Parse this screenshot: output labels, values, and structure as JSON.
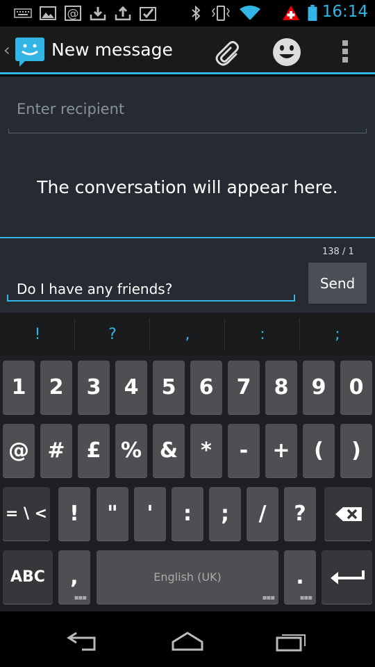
{
  "status_bar": {
    "time": "16:14",
    "icons": [
      "keyboard-icon",
      "gallery-icon",
      "email-icon",
      "download-icon",
      "upload-icon",
      "task-done-icon",
      "bluetooth-icon",
      "vibrate-icon",
      "wifi-icon",
      "swiss-flag-icon",
      "battery-icon"
    ]
  },
  "action_bar": {
    "title": "New message",
    "accent": "#33b5e5"
  },
  "compose": {
    "recipient_placeholder": "Enter recipient",
    "empty_message": "The conversation will appear here.",
    "char_count": "138 / 1",
    "message_text": "Do I have any friends?",
    "send_label": "Send"
  },
  "keyboard": {
    "suggestions": [
      "!",
      "?",
      ",",
      ":",
      ";"
    ],
    "row1": [
      "1",
      "2",
      "3",
      "4",
      "5",
      "6",
      "7",
      "8",
      "9",
      "0"
    ],
    "row2": [
      "@",
      "#",
      "£",
      "%",
      "&",
      "*",
      "-",
      "+",
      "(",
      ")"
    ],
    "row3": [
      "= \\ <",
      "!",
      "\"",
      "'",
      ":",
      ";",
      "/",
      "?"
    ],
    "row4": {
      "abc": "ABC",
      "comma": ",",
      "space": "English (UK)",
      "period": "."
    }
  }
}
